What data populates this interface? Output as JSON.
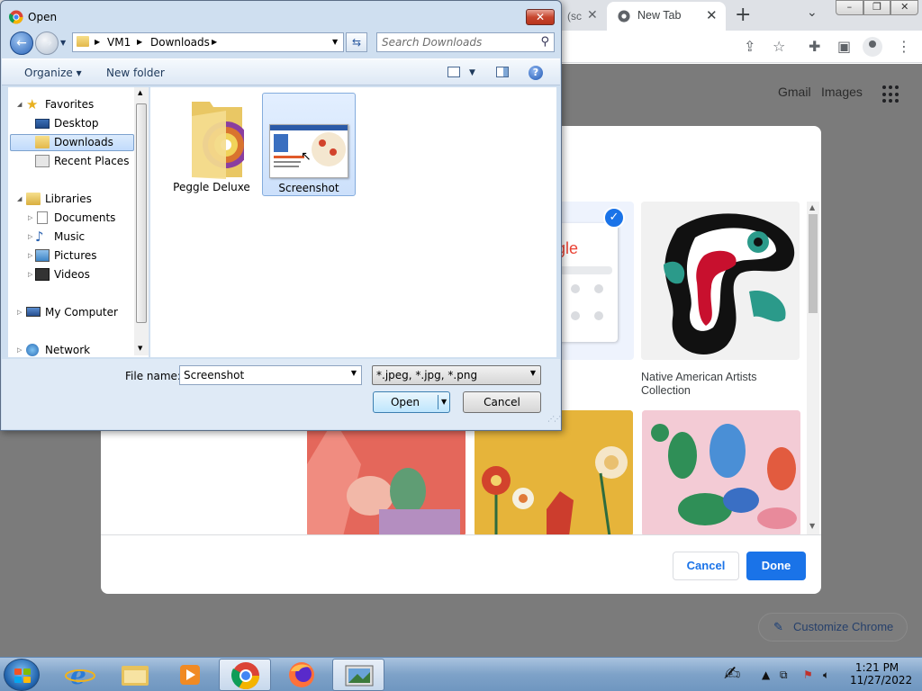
{
  "browser": {
    "tab_partial": "(sc",
    "tab_active": "New Tab",
    "new_tab_symbol": "+",
    "links": [
      "Gmail",
      "Images"
    ],
    "customize_chrome": "Customize Chrome",
    "accent": "#1a73e8"
  },
  "customize_dialog": {
    "tile_caption": "Native American Artists Collection",
    "cancel_label": "Cancel",
    "done_label": "Done",
    "google_fragment": "gle"
  },
  "open_dialog": {
    "title": "Open",
    "close_symbol": "✕",
    "address": [
      "VM1",
      "Downloads"
    ],
    "search_placeholder": "Search Downloads",
    "organize_label": "Organize",
    "new_folder_label": "New folder",
    "nav": {
      "favorites": "Favorites",
      "desktop": "Desktop",
      "downloads": "Downloads",
      "recent_places": "Recent Places",
      "libraries": "Libraries",
      "documents": "Documents",
      "music": "Music",
      "pictures": "Pictures",
      "videos": "Videos",
      "my_computer": "My Computer",
      "network": "Network"
    },
    "files": [
      {
        "name": "Peggle Deluxe",
        "type": "folder"
      },
      {
        "name": "Screenshot",
        "type": "image",
        "selected": true
      }
    ],
    "file_name_label": "File name:",
    "file_name_value": "Screenshot",
    "filter_value": "*.jpeg, *.jpg, *.png",
    "open_label": "Open",
    "cancel_label": "Cancel"
  },
  "taskbar": {
    "time": "1:21 PM",
    "date": "11/27/2022"
  }
}
